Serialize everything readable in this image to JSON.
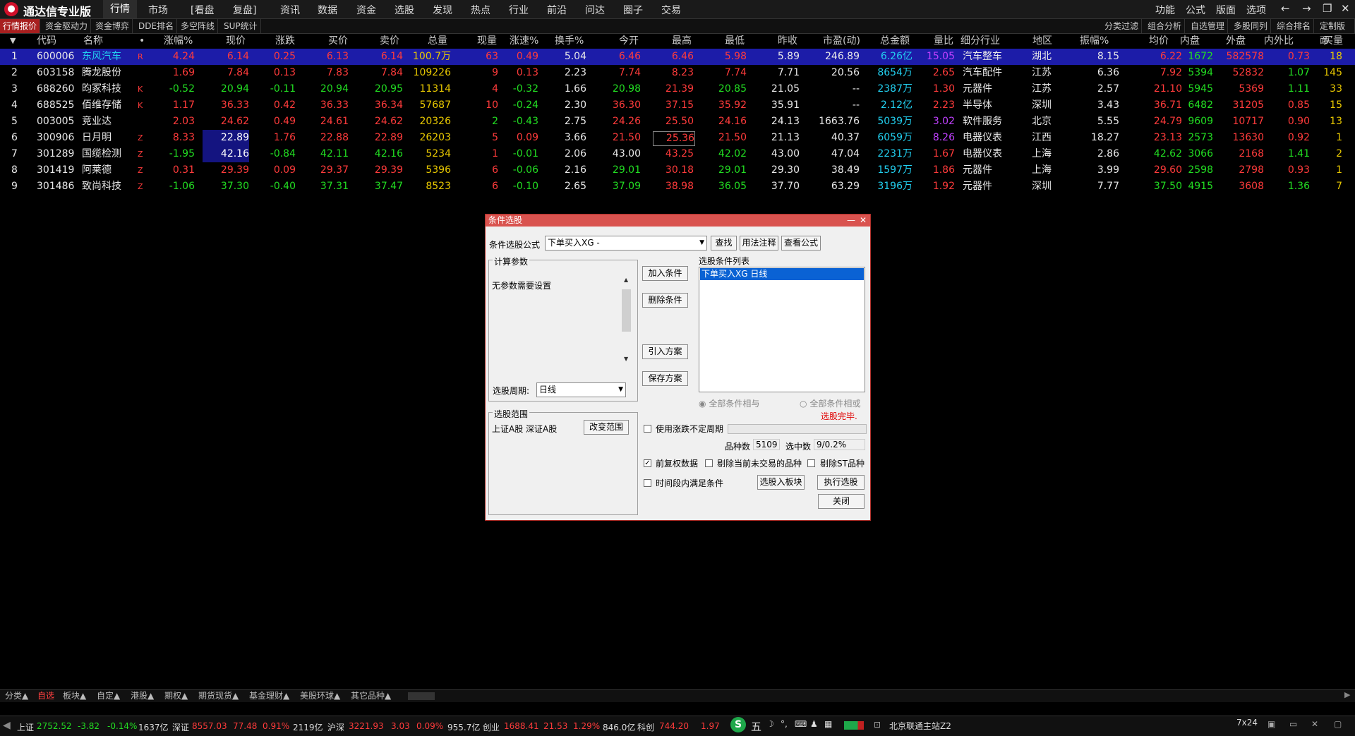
{
  "app": {
    "name": "通达信专业版",
    "logo": "●"
  },
  "menu": [
    "行情",
    "市场",
    "[看盘",
    "复盘]",
    "资讯",
    "数据",
    "资金",
    "选股",
    "发现",
    "热点",
    "行业",
    "前沿",
    "问达",
    "圈子",
    "交易"
  ],
  "right_menu": [
    "功能",
    "公式",
    "版面",
    "选项"
  ],
  "subtabs_left": [
    "行情报价",
    "资金驱动力",
    "资金博弈",
    "DDE排名",
    "多空阵线",
    "SUP统计"
  ],
  "subtabs_right": [
    "分类过滤",
    "组合分析",
    "自选管理",
    "多股同列",
    "综合排名",
    "定制版面"
  ],
  "columns": [
    "代码",
    "名称",
    "•",
    "涨幅%",
    "现价",
    "涨跌",
    "买价",
    "卖价",
    "总量",
    "现量",
    "涨速%",
    "换手%",
    "今开",
    "最高",
    "最低",
    "昨收",
    "市盈(动)",
    "总金额",
    "量比",
    "细分行业",
    "地区",
    "振幅%",
    "均价",
    "内盘",
    "外盘",
    "内外比",
    "买量"
  ],
  "rows": [
    {
      "n": "1",
      "code": "600006",
      "name": "东风汽车",
      "mark": "R",
      "chg": "4.24",
      "price": "6.14",
      "diff": "0.25",
      "bid": "6.13",
      "ask": "6.14",
      "vol": "100.7万",
      "cur": "63",
      "spd": "0.49",
      "turn": "5.04",
      "open": "6.46",
      "high": "6.46",
      "low": "5.98",
      "prev": "5.89",
      "pe": "246.89",
      "amt": "6.26亿",
      "vr": "15.05",
      "ind": "汽车整车",
      "area": "湖北",
      "amp": "8.15",
      "avg": "6.22",
      "inner": "1672",
      "outer": "582578",
      "ratio": "0.73",
      "bq": "18"
    },
    {
      "n": "2",
      "code": "603158",
      "name": "腾龙股份",
      "mark": "",
      "chg": "1.69",
      "price": "7.84",
      "diff": "0.13",
      "bid": "7.83",
      "ask": "7.84",
      "vol": "109226",
      "cur": "9",
      "spd": "0.13",
      "turn": "2.23",
      "open": "7.74",
      "high": "8.23",
      "low": "7.74",
      "prev": "7.71",
      "pe": "20.56",
      "amt": "8654万",
      "vr": "2.65",
      "ind": "汽车配件",
      "area": "江苏",
      "amp": "6.36",
      "avg": "7.92",
      "inner": "5394",
      "outer": "52832",
      "ratio": "1.07",
      "bq": "145"
    },
    {
      "n": "3",
      "code": "688260",
      "name": "昀冢科技",
      "mark": "K",
      "chg": "-0.52",
      "price": "20.94",
      "diff": "-0.11",
      "bid": "20.94",
      "ask": "20.95",
      "vol": "11314",
      "cur": "4",
      "spd": "-0.32",
      "turn": "1.66",
      "open": "20.98",
      "high": "21.39",
      "low": "20.85",
      "prev": "21.05",
      "pe": "--",
      "amt": "2387万",
      "vr": "1.30",
      "ind": "元器件",
      "area": "江苏",
      "amp": "2.57",
      "avg": "21.10",
      "inner": "5945",
      "outer": "5369",
      "ratio": "1.11",
      "bq": "33"
    },
    {
      "n": "4",
      "code": "688525",
      "name": "佰维存储",
      "mark": "K",
      "chg": "1.17",
      "price": "36.33",
      "diff": "0.42",
      "bid": "36.33",
      "ask": "36.34",
      "vol": "57687",
      "cur": "10",
      "spd": "-0.24",
      "turn": "2.30",
      "open": "36.30",
      "high": "37.15",
      "low": "35.92",
      "prev": "35.91",
      "pe": "--",
      "amt": "2.12亿",
      "vr": "2.23",
      "ind": "半导体",
      "area": "深圳",
      "amp": "3.43",
      "avg": "36.71",
      "inner": "6482",
      "outer": "31205",
      "ratio": "0.85",
      "bq": "15"
    },
    {
      "n": "5",
      "code": "003005",
      "name": "竞业达",
      "mark": "",
      "chg": "2.03",
      "price": "24.62",
      "diff": "0.49",
      "bid": "24.61",
      "ask": "24.62",
      "vol": "20326",
      "cur": "2",
      "spd": "-0.43",
      "turn": "2.75",
      "open": "24.26",
      "high": "25.50",
      "low": "24.16",
      "prev": "24.13",
      "pe": "1663.76",
      "amt": "5039万",
      "vr": "3.02",
      "ind": "软件服务",
      "area": "北京",
      "amp": "5.55",
      "avg": "24.79",
      "inner": "9609",
      "outer": "10717",
      "ratio": "0.90",
      "bq": "13"
    },
    {
      "n": "6",
      "code": "300906",
      "name": "日月明",
      "mark": "Z",
      "chg": "8.33",
      "price": "22.89",
      "diff": "1.76",
      "bid": "22.88",
      "ask": "22.89",
      "vol": "26203",
      "cur": "5",
      "spd": "0.09",
      "turn": "3.66",
      "open": "21.50",
      "high": "25.36",
      "low": "21.50",
      "prev": "21.13",
      "pe": "40.37",
      "amt": "6059万",
      "vr": "8.26",
      "ind": "电器仪表",
      "area": "江西",
      "amp": "18.27",
      "avg": "23.13",
      "inner": "2573",
      "outer": "13630",
      "ratio": "0.92",
      "bq": "1"
    },
    {
      "n": "7",
      "code": "301289",
      "name": "国缆检测",
      "mark": "Z",
      "chg": "-1.95",
      "price": "42.16",
      "diff": "-0.84",
      "bid": "42.11",
      "ask": "42.16",
      "vol": "5234",
      "cur": "1",
      "spd": "-0.01",
      "turn": "2.06",
      "open": "43.00",
      "high": "43.25",
      "low": "42.02",
      "prev": "43.00",
      "pe": "47.04",
      "amt": "2231万",
      "vr": "1.67",
      "ind": "电器仪表",
      "area": "上海",
      "amp": "2.86",
      "avg": "42.62",
      "inner": "3066",
      "outer": "2168",
      "ratio": "1.41",
      "bq": "2"
    },
    {
      "n": "8",
      "code": "301419",
      "name": "阿莱德",
      "mark": "Z",
      "chg": "0.31",
      "price": "29.39",
      "diff": "0.09",
      "bid": "29.37",
      "ask": "29.39",
      "vol": "5396",
      "cur": "6",
      "spd": "-0.06",
      "turn": "2.16",
      "open": "29.01",
      "high": "30.18",
      "low": "29.01",
      "prev": "29.30",
      "pe": "38.49",
      "amt": "1597万",
      "vr": "1.86",
      "ind": "元器件",
      "area": "上海",
      "amp": "3.99",
      "avg": "29.60",
      "inner": "2598",
      "outer": "2798",
      "ratio": "0.93",
      "bq": "1"
    },
    {
      "n": "9",
      "code": "301486",
      "name": "致尚科技",
      "mark": "Z",
      "chg": "-1.06",
      "price": "37.30",
      "diff": "-0.40",
      "bid": "37.31",
      "ask": "37.47",
      "vol": "8523",
      "cur": "6",
      "spd": "-0.10",
      "turn": "2.65",
      "open": "37.09",
      "high": "38.98",
      "low": "36.05",
      "prev": "37.70",
      "pe": "63.29",
      "amt": "3196万",
      "vr": "1.92",
      "ind": "元器件",
      "area": "深圳",
      "amp": "7.77",
      "avg": "37.50",
      "inner": "4915",
      "outer": "3608",
      "ratio": "1.36",
      "bq": "7"
    }
  ],
  "dialog": {
    "title": "条件选股",
    "formula_label": "条件选股公式",
    "formula_value": "下单买入XG   -",
    "btn_find": "查找",
    "btn_usage": "用法注释",
    "btn_view": "查看公式",
    "params_title": "计算参数",
    "params_text": "无参数需要设置",
    "period_label": "选股周期:",
    "period_value": "日线",
    "btn_add": "加入条件",
    "btn_del": "删除条件",
    "btn_import": "引入方案",
    "btn_save": "保存方案",
    "list_title": "选股条件列表",
    "list_item": "下单买入XG  日线",
    "radio_and": "全部条件相与",
    "radio_or": "全部条件相或",
    "status": "选股完毕.",
    "scope_title": "选股范围",
    "scope_text": "上证A股 深证A股",
    "btn_scope": "改变范围",
    "chk_period": "使用涨跌不定周期",
    "count_label": "品种数",
    "count_value": "5109",
    "selected_label": "选中数",
    "selected_value": "9/0.2%",
    "chk_fq": "前复权数据",
    "chk_notrade": "剔除当前未交易的品种",
    "chk_st": "剔除ST品种",
    "chk_time": "时间段内满足条件",
    "btn_toblock": "选股入板块",
    "btn_exec": "执行选股",
    "btn_close": "关闭"
  },
  "bottom_tabs": [
    "分类▲",
    "自选",
    "板块▲",
    "自定▲",
    "港股▲",
    "期权▲",
    "期货现货▲",
    "基金理财▲",
    "美股环球▲",
    "其它品种▲"
  ],
  "status": {
    "sh_label": "上证",
    "sh": "2752.52",
    "sh_d": "-3.82",
    "sh_p": "-0.14%",
    "sh_a": "1637亿",
    "sz_label": "深证",
    "sz": "8557.03",
    "sz_d": "77.48",
    "sz_p": "0.91%",
    "sz_a": "2119亿",
    "hs_label": "沪深",
    "hs": "3221.93",
    "hs_d": "3.03",
    "hs_p": "0.09%",
    "hs_a": "955.7亿",
    "cy_label": "创业",
    "cy": "1688.41",
    "cy_d": "21.53",
    "cy_p": "1.29%",
    "cy_a": "846.0亿",
    "kc_label": "科创",
    "kc": "744.20",
    "kc_d": "1.97",
    "ime": "五",
    "server": "北京联通主站Z2",
    "clock": "7x24"
  },
  "colors": {
    "up": "#ff3b3b",
    "down": "#22dd22",
    "selected_row": "#1c1ca8",
    "dialog_title": "#d9534f"
  }
}
